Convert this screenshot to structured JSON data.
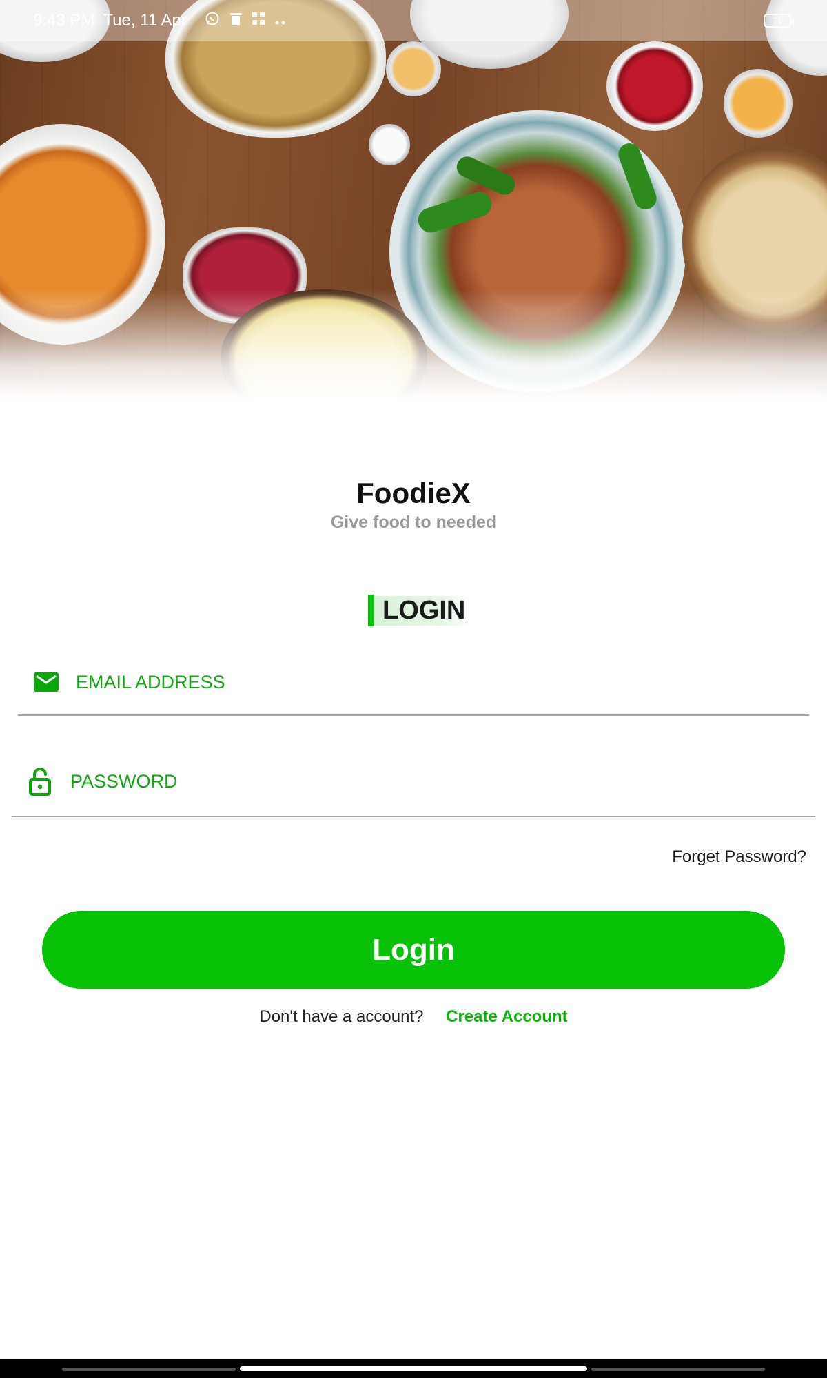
{
  "status_bar": {
    "time": "9:43 PM",
    "date": "Tue, 11 Apr",
    "battery_level": "71",
    "notification_icons": [
      "whatsapp-icon",
      "delete-icon",
      "apps-icon",
      "more-dots-icon"
    ]
  },
  "hero": {
    "image_subject": "overhead table of dishes: roasted vegetables, casserole, grilled chicken with peppers, berries, bread rolls"
  },
  "brand": {
    "title": "FoodieX",
    "subtitle": "Give food to needed"
  },
  "login": {
    "heading": "LOGIN",
    "email_placeholder": "EMAIL ADDRESS",
    "password_placeholder": "PASSWORD",
    "forgot_password": "Forget Password?",
    "button_label": "Login",
    "no_account_prompt": "Don't have a account?",
    "create_account": "Create Account"
  },
  "colors": {
    "accent": "#07c207",
    "accent_text": "#0ab20a",
    "subtitle": "#9a9a9a",
    "divider": "#a8a8a8"
  }
}
